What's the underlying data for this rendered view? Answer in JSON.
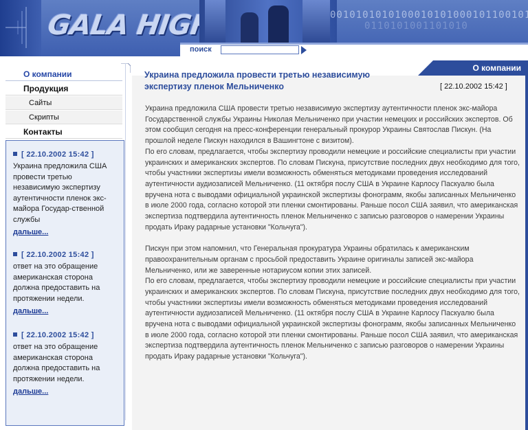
{
  "header": {
    "logo": "GALA HIGHTECH",
    "binary_row1": "0010101010100010101000101100101",
    "binary_row2": "0110101001101010",
    "search_label": "поиск",
    "search_value": ""
  },
  "nav": {
    "items": [
      {
        "label": "О компании",
        "active": true
      },
      {
        "label": "Продукция",
        "active": false
      },
      {
        "label": "Сайты",
        "sub": true
      },
      {
        "label": "Скрипты",
        "sub": true
      },
      {
        "label": "Контакты",
        "active": false
      }
    ]
  },
  "news": [
    {
      "date": "[ 22.10.2002 15:42 ]",
      "text": "Украина предложила США провести третью независимую экспертизу аутентичности пленок экс-майора Государ-ственной службы",
      "more": "дальше..."
    },
    {
      "date": "[ 22.10.2002 15:42 ]",
      "text": "ответ на это обращение американская сторона должна предоставить на протяжении недели.",
      "more": "дальше..."
    },
    {
      "date": "[ 22.10.2002 15:42 ]",
      "text": "ответ на это обращение американская сторона должна предоставить на протяжении недели.",
      "more": "дальше..."
    }
  ],
  "main": {
    "tab_label": "О компании",
    "title": "Украина предложила провести третью независимую экспертизу пленок Мельниченко",
    "date": "[ 22.10.2002 15:42 ]",
    "paragraphs": [
      "Украина предложила США провести третью независимую экспертизу аутентичности пленок экс-майора Государственной службы Украины Николая Мельниченко при участии немецких и российских экспертов. Об этом сообщил сегодня на пресс-конференции генеральный прокурор Украины Святослав Пискун. (На прошлой неделе Пискун находился в Вашингтоне с визитом).",
      "По его словам, предлагается, чтобы экспертизу проводили немецкие и российские специалисты при участии украинских и американских экспертов. По словам Пискуна, присутствие последних двух необходимо для того, чтобы участники экспертизы имели возможность обменяться методиками проведения исследований аутентичности аудиозаписей Мельниченко. (11 октября послу США в Украине Карлосу Паскуалю была вручена нота с выводами официальной украинской экспертизы фонограмм, якобы записанных Мельниченко в июле 2000 года, согласно которой эти пленки смонтированы. Раньше посол США заявил, что американская экспертиза подтвердила аутентичность пленок Мельниченко с записью разговоров о намерении Украины продать Ираку радарные установки \"Кольчуга\").",
      "Пискун при этом напомнил, что Генеральная прокуратура Украины обратилась к американским правоохранительным органам с просьбой предоставить Украине оригиналы записей экс-майора Мельниченко, или же заверенные нотариусом копии этих записей.",
      "По его словам, предлагается, чтобы экспертизу проводили немецкие и российские специалисты при участии украинских и американских экспертов. По словам Пискуна, присутствие последних двух необходимо для того, чтобы участники экспертизы имели возможность обменяться методиками проведения исследований аутентичности аудиозаписей Мельниченко. (11 октября послу США в Украине Карлосу Паскуалю была вручена нота с выводами официальной украинской экспертизы фонограмм, якобы записанных Мельниченко в июле 2000 года, согласно которой эти пленки смонтированы. Раньше посол США заявил, что американская экспертиза подтвердила аутентичность пленок Мельниченко с записью разговоров о намерении Украины продать Ираку радарные установки \"Кольчуга\")."
    ]
  },
  "colors": {
    "brand_blue": "#2d4d9c",
    "header_blue": "#3e5fb0",
    "news_bg": "#eaeff8",
    "panel_bg": "#f3f3f3"
  }
}
